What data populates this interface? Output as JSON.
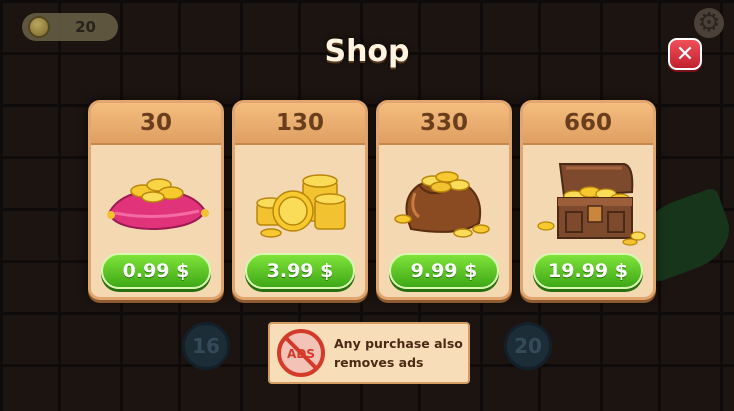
{
  "hud": {
    "coins": "20",
    "coin_icon": "coin-icon",
    "settings_icon": "gear-icon"
  },
  "background_levels": [
    "16",
    "20"
  ],
  "shop": {
    "title": "Shop",
    "close_icon": "close-icon",
    "products": [
      {
        "amount": "30",
        "price": "0.99 $",
        "art": "coin-pillow"
      },
      {
        "amount": "130",
        "price": "3.99 $",
        "art": "coin-stacks"
      },
      {
        "amount": "330",
        "price": "9.99 $",
        "art": "coin-sack"
      },
      {
        "amount": "660",
        "price": "19.99 $",
        "art": "treasure-chest"
      }
    ],
    "ads_note": {
      "icon_text": "ADS",
      "text": "Any purchase also\nremoves ads"
    }
  },
  "colors": {
    "price_button": "#4cc020",
    "card_header": "#eeb273",
    "close_button": "#e0323e"
  }
}
